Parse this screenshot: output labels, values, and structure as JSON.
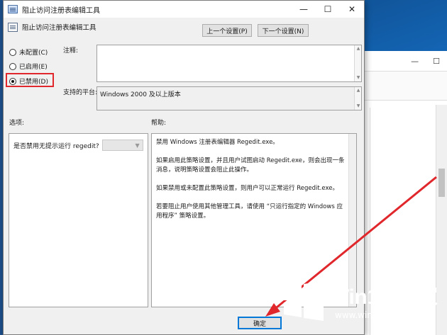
{
  "window": {
    "title": "阻止访问注册表编辑工具",
    "controls": {
      "minimize": "—",
      "maximize": "☐",
      "close": "✕"
    }
  },
  "header": {
    "setting_name": "阻止访问注册表编辑工具",
    "prev_button": "上一个设置(P)",
    "next_button": "下一个设置(N)"
  },
  "state": {
    "options": [
      {
        "label": "未配置(C)",
        "checked": false
      },
      {
        "label": "已启用(E)",
        "checked": false
      },
      {
        "label": "已禁用(D)",
        "checked": true
      }
    ]
  },
  "comment": {
    "label": "注释:",
    "value": ""
  },
  "platform": {
    "label": "支持的平台:",
    "value": "Windows 2000 及以上版本"
  },
  "options_section": {
    "label": "选项:",
    "item_label": "是否禁用无提示运行 regedit?",
    "selected_value": ""
  },
  "help_section": {
    "label": "帮助:",
    "paragraphs": [
      "禁用 Windows 注册表编辑器 Regedit.exe。",
      "如果启用此策略设置，并且用户试图启动 Regedit.exe，则会出现一条消息，说明策略设置会阻止此操作。",
      "如果禁用或未配置此策略设置，则用户可以正常运行 Regedit.exe。",
      "若要阻止用户使用其他管理工具，请使用 “只运行指定的 Windows 应用程序” 策略设置。"
    ]
  },
  "footer": {
    "ok_button": "确定"
  },
  "background_window": {
    "minimize": "—",
    "maximize": "☐"
  },
  "watermark": {
    "brand": "Win10 之家",
    "url": "www.win10xitong.com"
  },
  "colors": {
    "highlight_border": "#e0272c",
    "arrow": "#e0272c",
    "desktop": "#1467b8"
  }
}
